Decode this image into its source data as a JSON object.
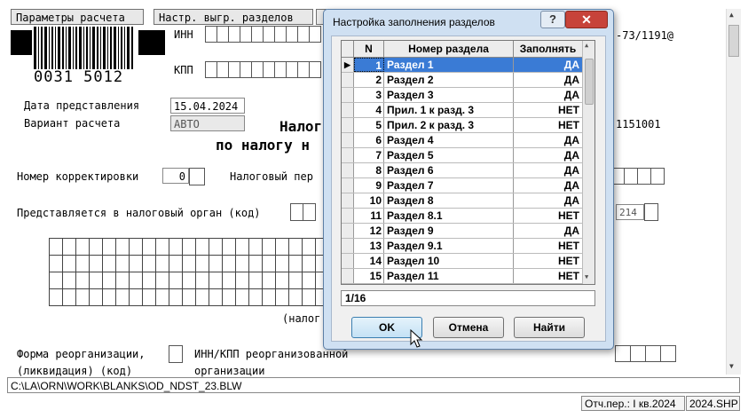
{
  "toolbar": {
    "params_btn": "Параметры расчета",
    "sections_btn": "Настр. выгр. разделов"
  },
  "form": {
    "barcode_number": "0031 5012",
    "inn_label": "ИНН",
    "kpp_label": "КПП",
    "inn_right": "-73/1191@",
    "kpp_right": "1151001",
    "date_label": "Дата представления",
    "date_value": "15.04.2024",
    "variant_label": "Вариант расчета",
    "variant_value": "АВТО",
    "title_line1": "Налог",
    "title_line2": "по налогу н",
    "corr_label": "Номер корректировки",
    "corr_value": "0",
    "period_label": "Налоговый пер",
    "organ_label": "Представляется в налоговый орган (код)",
    "organ_right_value": "214",
    "nalog_caption": "(налог",
    "reorg_label_1": "Форма реорганизации,",
    "reorg_label_2": "(ликвидация) (код)",
    "reorg_inn_label_1": "ИНН/КПП реорганизованной",
    "reorg_inn_label_2": "организации"
  },
  "statusbar": {
    "path": "C:\\LA\\ORN\\WORK\\BLANKS\\OD_NDST_23.BLW",
    "period": "Отч.пер.: I кв.2024",
    "file": "2024.SHP"
  },
  "dialog": {
    "title": "Настройка заполнения разделов",
    "help": "?",
    "close": "✕",
    "columns": [
      "N",
      "Номер раздела",
      "Заполнять"
    ],
    "rows": [
      {
        "n": "1",
        "name": "Раздел 1",
        "fill": "ДА"
      },
      {
        "n": "2",
        "name": "Раздел 2",
        "fill": "ДА"
      },
      {
        "n": "3",
        "name": "Раздел 3",
        "fill": "ДА"
      },
      {
        "n": "4",
        "name": "Прил. 1 к разд. 3",
        "fill": "НЕТ"
      },
      {
        "n": "5",
        "name": "Прил. 2 к разд. 3",
        "fill": "НЕТ"
      },
      {
        "n": "6",
        "name": "Раздел 4",
        "fill": "ДА"
      },
      {
        "n": "7",
        "name": "Раздел 5",
        "fill": "ДА"
      },
      {
        "n": "8",
        "name": "Раздел 6",
        "fill": "ДА"
      },
      {
        "n": "9",
        "name": "Раздел 7",
        "fill": "ДА"
      },
      {
        "n": "10",
        "name": "Раздел 8",
        "fill": "ДА"
      },
      {
        "n": "11",
        "name": "Раздел 8.1",
        "fill": "НЕТ"
      },
      {
        "n": "12",
        "name": "Раздел 9",
        "fill": "ДА"
      },
      {
        "n": "13",
        "name": "Раздел 9.1",
        "fill": "НЕТ"
      },
      {
        "n": "14",
        "name": "Раздел 10",
        "fill": "НЕТ"
      },
      {
        "n": "15",
        "name": "Раздел 11",
        "fill": "НЕТ"
      }
    ],
    "counter": "1/16",
    "ok": "OK",
    "cancel": "Отмена",
    "find": "Найти"
  }
}
